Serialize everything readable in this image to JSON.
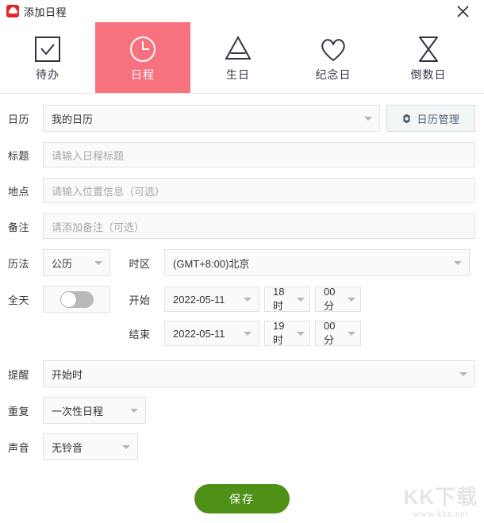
{
  "window": {
    "title": "添加日程",
    "app_icon": "cloud-app-icon",
    "close_icon": "close-icon",
    "accent_color": "#f7717f",
    "save_color": "#4f9018"
  },
  "tabs": [
    {
      "label": "待办",
      "icon": "checkbox-icon",
      "active": false
    },
    {
      "label": "日程",
      "icon": "clock-icon",
      "active": true
    },
    {
      "label": "生日",
      "icon": "cake-icon",
      "active": false
    },
    {
      "label": "纪念日",
      "icon": "heart-icon",
      "active": false
    },
    {
      "label": "倒数日",
      "icon": "hourglass-icon",
      "active": false
    }
  ],
  "form": {
    "calendar": {
      "label": "日历",
      "value": "我的日历",
      "manage_button": "日历管理",
      "manage_icon": "gear-icon"
    },
    "title": {
      "label": "标题",
      "value": "",
      "placeholder": "请输入日程标题"
    },
    "location": {
      "label": "地点",
      "value": "",
      "placeholder": "请输入位置信息（可选）"
    },
    "note": {
      "label": "备注",
      "value": "",
      "placeholder": "请添加备注（可选）"
    },
    "calendar_system": {
      "label": "历法",
      "value": "公历"
    },
    "timezone": {
      "label": "时区",
      "value": "(GMT+8:00)北京"
    },
    "all_day": {
      "label": "全天",
      "state": "off"
    },
    "start": {
      "label": "开始",
      "date": "2022-05-11",
      "hour": "18时",
      "minute": "00分"
    },
    "end": {
      "label": "结束",
      "date": "2022-05-11",
      "hour": "19时",
      "minute": "00分"
    },
    "reminder": {
      "label": "提醒",
      "value": "开始时"
    },
    "repeat": {
      "label": "重复",
      "value": "一次性日程"
    },
    "sound": {
      "label": "声音",
      "value": "无铃音"
    },
    "save_button": "保存"
  },
  "watermark": {
    "main": "KK下载",
    "sub": "www.kkx.net"
  }
}
